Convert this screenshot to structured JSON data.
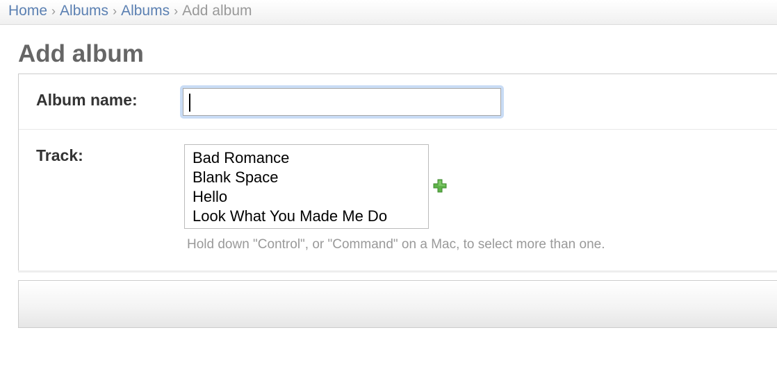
{
  "breadcrumbs": {
    "items": [
      {
        "label": "Home"
      },
      {
        "label": "Albums"
      },
      {
        "label": "Albums"
      }
    ],
    "separator": "›",
    "current": "Add album"
  },
  "page": {
    "title": "Add album"
  },
  "form": {
    "album_name": {
      "label": "Album name:",
      "value": ""
    },
    "track": {
      "label": "Track:",
      "options": [
        "Bad Romance",
        "Blank Space",
        "Hello",
        "Look What You Made Me Do"
      ],
      "add_icon": "plus-icon",
      "help_text": "Hold down \"Control\", or \"Command\" on a Mac, to select more than one."
    }
  },
  "colors": {
    "link": "#5b80b2",
    "focus_ring": "#c9dcf5",
    "add_icon_green": "#4ea53a",
    "help_text": "#999999"
  }
}
